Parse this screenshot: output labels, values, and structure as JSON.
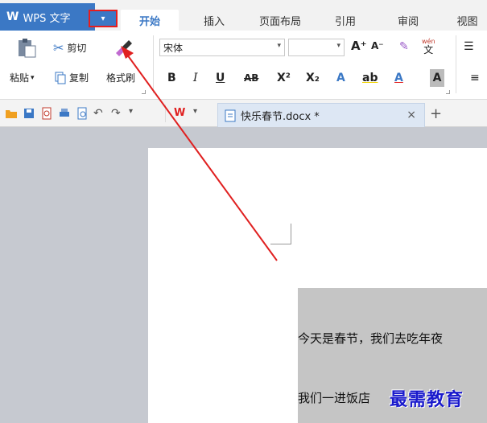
{
  "titlebar": {
    "app_logo": "W",
    "app_name": "WPS 文字",
    "menu_arrow": "▾",
    "tabs": [
      {
        "label": "开始",
        "active": true
      },
      {
        "label": "插入",
        "active": false
      },
      {
        "label": "页面布局",
        "active": false
      },
      {
        "label": "引用",
        "active": false
      },
      {
        "label": "审阅",
        "active": false
      },
      {
        "label": "视图",
        "active": false
      }
    ]
  },
  "ribbon": {
    "paste_label": "粘贴",
    "cut_label": "剪切",
    "copy_label": "复制",
    "format_painter_label": "格式刷",
    "font_name": "宋体",
    "bold": "B",
    "italic": "I",
    "underline": "U",
    "strikethrough": "AB",
    "superscript": "X²",
    "subscript": "X₂",
    "grow_font": "A⁺",
    "shrink_font": "A⁻",
    "phonetic": "wén",
    "phonetic_char": "文",
    "font_color": "A",
    "highlight": "ab",
    "char_shading": "A"
  },
  "doc_tab": {
    "name": "快乐春节.docx *",
    "close": "×",
    "new_tab": "+"
  },
  "document": {
    "paragraph_1": "今天是春节，我们去吃年夜",
    "paragraph_2": "我们一进饭店"
  },
  "watermark": "最需教育",
  "colors": {
    "app_blue": "#3b78c5",
    "highlight_red": "#e61e1e",
    "arrow_red": "#e02020",
    "selection_gray": "#c5c5c5",
    "watermark_blue": "#1a1acc"
  },
  "icons": [
    "paste-icon",
    "cut-icon",
    "copy-icon",
    "format-painter-icon",
    "open-icon",
    "save-icon",
    "print-icon",
    "undo-icon",
    "redo-icon",
    "wps-logo-icon",
    "doc-icon"
  ]
}
